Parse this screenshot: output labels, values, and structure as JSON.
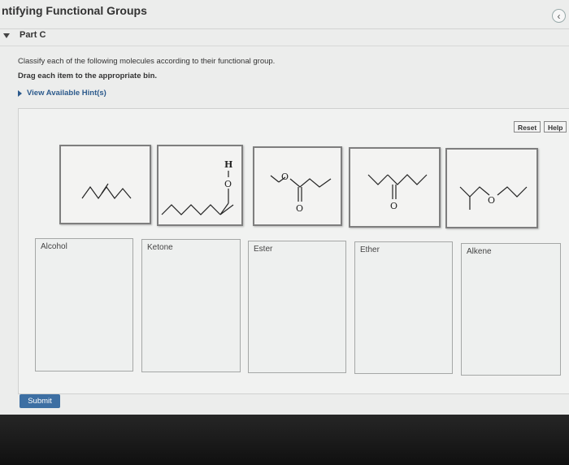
{
  "header": {
    "title": "ntifying Functional Groups",
    "back_icon": "chevron-left-icon"
  },
  "part": {
    "label": "Part C"
  },
  "instructions": {
    "text": "Classify each of the following molecules according to their functional group.",
    "bold_text": "Drag each item to the appropriate bin.",
    "hint_link": "View Available Hint(s)"
  },
  "toolbar": {
    "reset_label": "Reset",
    "help_label": "Help"
  },
  "molecules": [
    {
      "name": "molecule-1",
      "atom_labels": []
    },
    {
      "name": "molecule-2",
      "atom_labels": [
        "H",
        "O"
      ]
    },
    {
      "name": "molecule-3",
      "atom_labels": [
        "O",
        "O"
      ]
    },
    {
      "name": "molecule-4",
      "atom_labels": [
        "O"
      ]
    },
    {
      "name": "molecule-5",
      "atom_labels": [
        "O"
      ]
    }
  ],
  "bins": [
    {
      "label": "Alcohol"
    },
    {
      "label": "Ketone"
    },
    {
      "label": "Ester"
    },
    {
      "label": "Ether"
    },
    {
      "label": "Alkene"
    }
  ],
  "submit": {
    "label": "Submit"
  },
  "colors": {
    "accent": "#3d6fa3",
    "link": "#2c5a8c"
  }
}
